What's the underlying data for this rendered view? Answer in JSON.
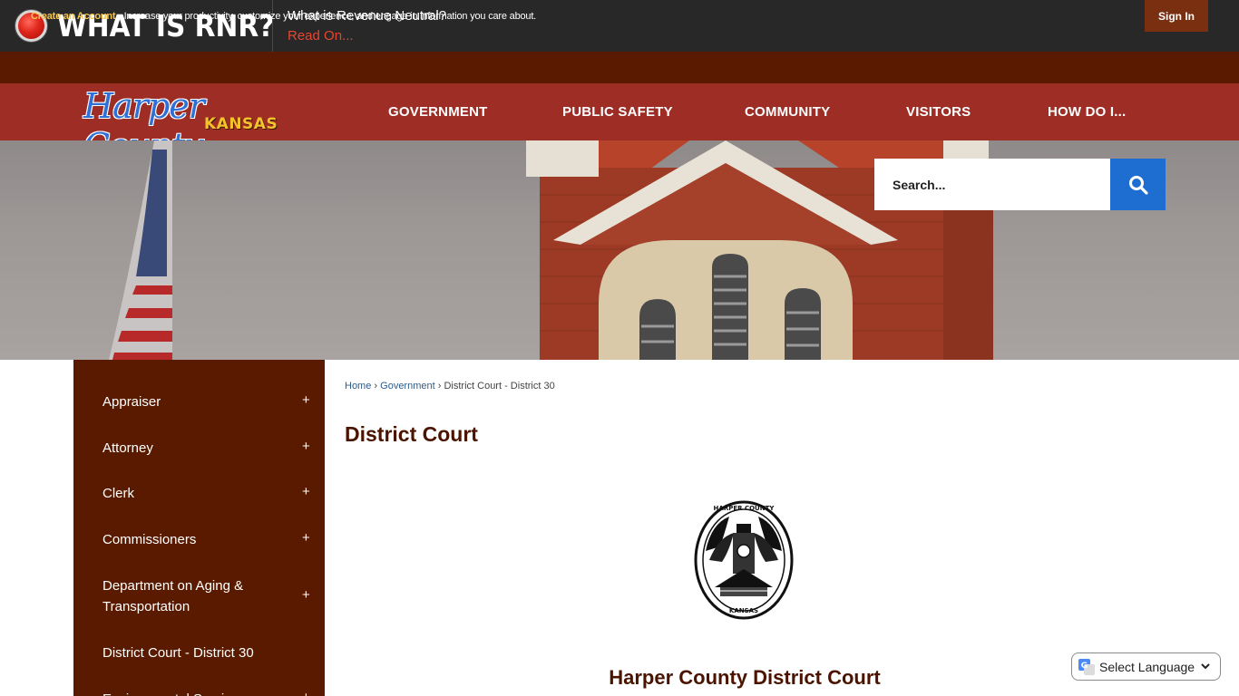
{
  "alert": {
    "title": "WHAT IS RNR?",
    "question": "What is Revenue Neutral?",
    "link": "Read On..."
  },
  "account": {
    "create_link": "Create an Account",
    "message": " - Increase your productivity, customize your experience, and engage in information you care about.",
    "sign_in": "Sign In"
  },
  "logo": {
    "script_text": "Harper County",
    "sub_text": "KANSAS"
  },
  "nav": {
    "items": [
      "GOVERNMENT",
      "PUBLIC SAFETY",
      "COMMUNITY",
      "VISITORS",
      "HOW DO I..."
    ]
  },
  "search": {
    "placeholder": "Search..."
  },
  "sidebar": {
    "items": [
      {
        "label": "Appraiser",
        "expand": "+"
      },
      {
        "label": "Attorney",
        "expand": "+"
      },
      {
        "label": "Clerk",
        "expand": "+"
      },
      {
        "label": "Commissioners",
        "expand": "+"
      },
      {
        "label": "Department on Aging & Transportation",
        "expand": "+"
      },
      {
        "label": "District Court - District 30",
        "expand": ""
      },
      {
        "label": "Environmental Services",
        "expand": "+"
      }
    ]
  },
  "breadcrumb": {
    "home": "Home",
    "sep": "›",
    "government": "Government",
    "current": "District Court - District 30"
  },
  "page": {
    "title": "District Court",
    "heading": "Harper County District Court"
  },
  "seal": {
    "top_text": "HARPER COUNTY",
    "bottom_text": "KANSAS"
  },
  "language": {
    "label": "Select Language"
  }
}
